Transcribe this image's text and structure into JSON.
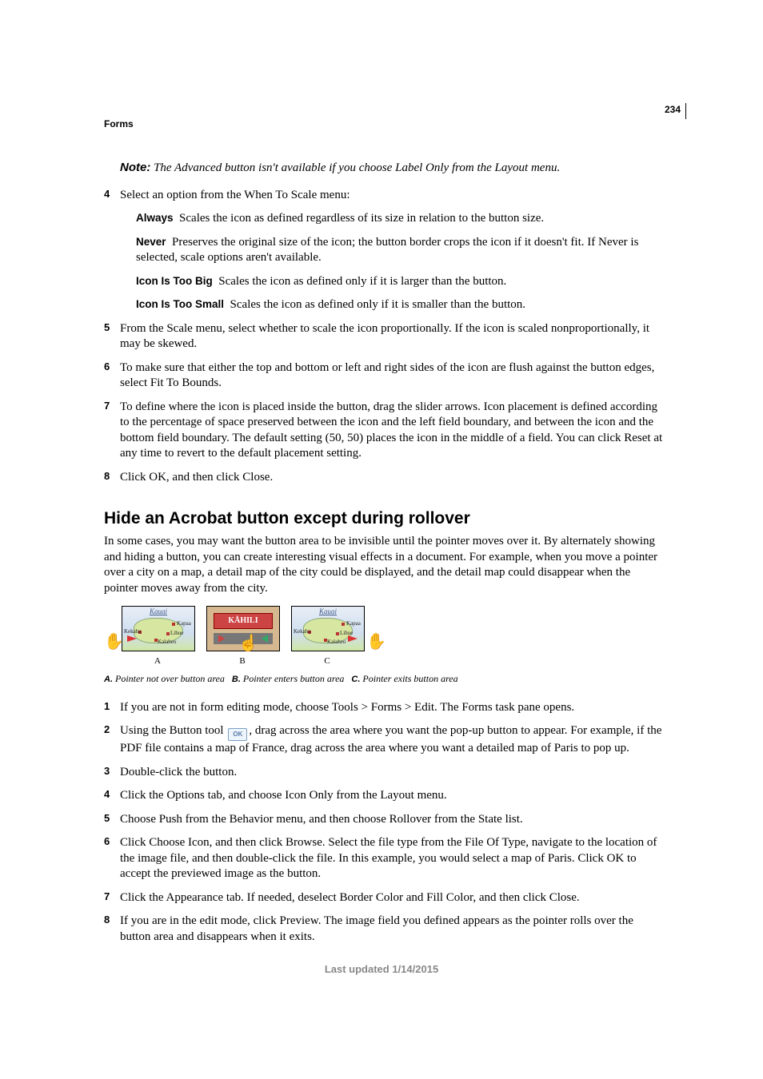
{
  "page_number": "234",
  "breadcrumb": "Forms",
  "note": {
    "label": "Note:",
    "text": " The Advanced button isn't available if you choose Label Only from the Layout menu."
  },
  "step4": {
    "num": "4",
    "text": "Select an option from the When To Scale menu:"
  },
  "options": {
    "always": {
      "label": "Always",
      "text": "Scales the icon as defined regardless of its size in relation to the button size."
    },
    "never": {
      "label": "Never",
      "text": "Preserves the original size of the icon; the button border crops the icon if it doesn't fit. If Never is selected, scale options aren't available."
    },
    "too_big": {
      "label": "Icon Is Too Big",
      "text": "Scales the icon as defined only if it is larger than the button."
    },
    "too_small": {
      "label": "Icon Is Too Small",
      "text": "Scales the icon as defined only if it is smaller than the button."
    }
  },
  "step5": {
    "num": "5",
    "text": "From the Scale menu, select whether to scale the icon proportionally. If the icon is scaled nonproportionally, it may be skewed."
  },
  "step6": {
    "num": "6",
    "text": "To make sure that either the top and bottom or left and right sides of the icon are flush against the button edges, select Fit To Bounds."
  },
  "step7": {
    "num": "7",
    "text": "To define where the icon is placed inside the button, drag the slider arrows. Icon placement is defined according to the percentage of space preserved between the icon and the left field boundary, and between the icon and the bottom field boundary. The default setting (50, 50) places the icon in the middle of a field. You can click Reset at any time to revert to the default placement setting."
  },
  "step8": {
    "num": "8",
    "text": "Click OK, and then click Close."
  },
  "section_heading": "Hide an Acrobat button except during rollover",
  "section_intro": "In some cases, you may want the button area to be invisible until the pointer moves over it. By alternately showing and hiding a button, you can create interesting visual effects in a document. For example, when you move a pointer over a city on a map, a detail map of the city could be displayed, and the detail map could disappear when the pointer moves away from the city.",
  "figure": {
    "thumb_a_title": "Kauai",
    "thumb_a_labels": {
      "kapaa": "Kapaa",
      "kekaha": "Kekaha",
      "lihue": "Lihue",
      "kalaheo": "Kalaheo"
    },
    "thumb_b_banner": "KĀHILI",
    "thumb_c_title": "Kauai",
    "thumb_c_labels": {
      "kapaa": "Kapaa",
      "kekaha": "Kekaha",
      "lihue": "Lihue",
      "kalaheo": "Kalaheo"
    },
    "cap_a": "A",
    "cap_b": "B",
    "cap_c": "C"
  },
  "figure_caption": {
    "a_label": "A.",
    "a_text": "Pointer not over button area",
    "b_label": "B.",
    "b_text": "Pointer enters button area",
    "c_label": "C.",
    "c_text": "Pointer exits button area"
  },
  "h_step1": {
    "num": "1",
    "text": "If you are not in form editing mode, choose Tools > Forms > Edit. The Forms task pane opens."
  },
  "h_step2": {
    "num": "2",
    "pre": "Using the Button tool ",
    "icon_text": "OK",
    "post": ", drag across the area where you want the pop-up button to appear. For example, if the PDF file contains a map of France, drag across the area where you want a detailed map of Paris to pop up."
  },
  "h_step3": {
    "num": "3",
    "text": "Double-click the button."
  },
  "h_step4": {
    "num": "4",
    "text": "Click the Options tab, and choose Icon Only from the Layout menu."
  },
  "h_step5": {
    "num": "5",
    "text": "Choose Push from the Behavior menu, and then choose Rollover from the State list."
  },
  "h_step6": {
    "num": "6",
    "text": "Click Choose Icon, and then click Browse. Select the file type from the File Of Type, navigate to the location of the image file, and then double-click the file. In this example, you would select a map of Paris. Click OK to accept the previewed image as the button."
  },
  "h_step7": {
    "num": "7",
    "text": "Click the Appearance tab. If needed, deselect Border Color and Fill Color, and then click Close."
  },
  "h_step8": {
    "num": "8",
    "text": "If you are in the edit mode, click Preview. The image field you defined appears as the pointer rolls over the button area and disappears when it exits."
  },
  "footer": "Last updated 1/14/2015"
}
